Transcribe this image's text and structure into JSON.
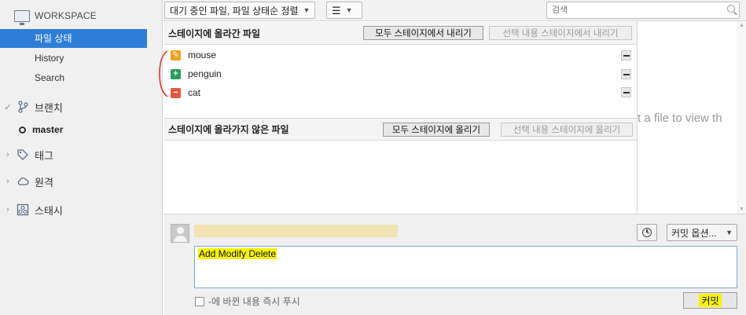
{
  "sidebar": {
    "workspace_label": "WORKSPACE",
    "workspace_items": [
      {
        "label": "파일 상태",
        "active": true
      },
      {
        "label": "History",
        "active": false
      },
      {
        "label": "Search",
        "active": false
      }
    ],
    "branches_label": "브랜치",
    "current_branch": "master",
    "tags_label": "태그",
    "remotes_label": "원격",
    "stashes_label": "스태시"
  },
  "toolbar": {
    "sort_label": "대기 중인 파일, 파일 상태순 정렬",
    "view_icon": "list-icon",
    "search_placeholder": "검색"
  },
  "staged": {
    "title": "스테이지에 올라간 파일",
    "unstage_all": "모두 스테이지에서 내리기",
    "unstage_selected": "선택 내용 스테이지에서 내리기",
    "files": [
      {
        "name": "mouse",
        "status": "modified",
        "color": "#f1a219"
      },
      {
        "name": "penguin",
        "status": "added",
        "color": "#27a05d"
      },
      {
        "name": "cat",
        "status": "removed",
        "color": "#e8573f"
      }
    ]
  },
  "unstaged": {
    "title": "스테이지에 올라가지 않은 파일",
    "stage_all": "모두 스테이지에 올리기",
    "stage_selected": "선택 내용 스테이지에 올리기"
  },
  "preview": {
    "text": "t a file to view th"
  },
  "commit": {
    "message": "Add Modify Delete",
    "options_label": "커밋 옵션...",
    "push_label": "-에 바뀐 내용 즉시 푸시",
    "commit_label": "커밋",
    "highlight_color": "#f7f300"
  }
}
